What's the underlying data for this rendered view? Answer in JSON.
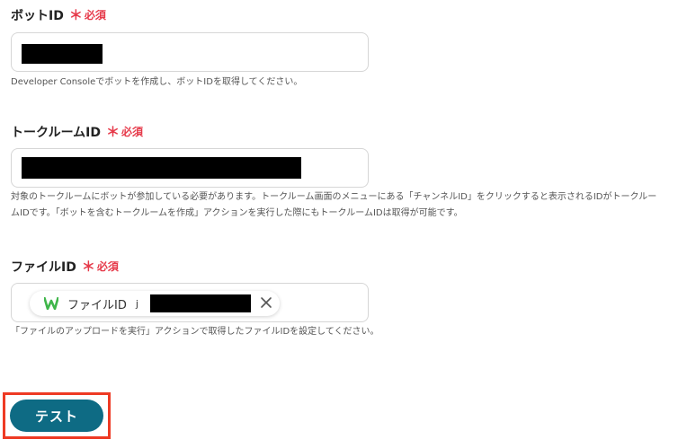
{
  "fields": {
    "bot_id": {
      "label": "ボットID",
      "required_mark": "＊",
      "required_text": "必須",
      "help": "Developer Consoleでボットを作成し、ボットIDを取得してください。"
    },
    "talkroom_id": {
      "label": "トークルームID",
      "required_mark": "＊",
      "required_text": "必須",
      "help_line1": "対象のトークルームにボットが参加している必要があります。トークルーム画面のメニューにある「チャンネルID」をクリックすると表示されるIDがトークルー",
      "help_line2": "ムIDです。「ボットを含むトークルームを作成」アクションを実行した際にもトークルームIDは取得が可能です。"
    },
    "file_id": {
      "label": "ファイルID",
      "required_mark": "＊",
      "required_text": "必須",
      "chip_label": "ファイルID",
      "chip_prefix": "j",
      "help": "「ファイルのアップロードを実行」アクションで取得したファイルIDを設定してください。"
    }
  },
  "test_button": {
    "label": "テスト"
  },
  "colors": {
    "required": "#e63a4a",
    "button": "#0e6b84",
    "highlight": "#ee3a24",
    "chip_icon": "#3fb64a"
  },
  "icons": {
    "chip_icon": "line-works-logo-icon",
    "chip_close": "close-icon"
  }
}
